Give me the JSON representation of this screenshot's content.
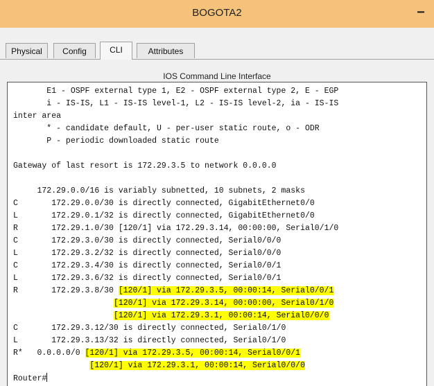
{
  "window": {
    "title": "BOGOTA2",
    "minimize_label": "−"
  },
  "tabs": [
    {
      "label": "Physical",
      "active": false
    },
    {
      "label": "Config",
      "active": false
    },
    {
      "label": "CLI",
      "active": true
    },
    {
      "label": "Attributes",
      "active": false
    }
  ],
  "panel_title": "IOS Command Line Interface",
  "terminal": {
    "lines": [
      "       E1 - OSPF external type 1, E2 - OSPF external type 2, E - EGP",
      "       i - IS-IS, L1 - IS-IS level-1, L2 - IS-IS level-2, ia - IS-IS",
      "inter area",
      "       * - candidate default, U - per-user static route, o - ODR",
      "       P - periodic downloaded static route",
      "",
      "Gateway of last resort is 172.29.3.5 to network 0.0.0.0",
      "",
      "     172.29.0.0/16 is variably subnetted, 10 subnets, 2 masks",
      "C       172.29.0.0/30 is directly connected, GigabitEthernet0/0",
      "L       172.29.0.1/32 is directly connected, GigabitEthernet0/0",
      "R       172.29.1.0/30 [120/1] via 172.29.3.14, 00:00:00, Serial0/1/0",
      "C       172.29.3.0/30 is directly connected, Serial0/0/0",
      "L       172.29.3.2/32 is directly connected, Serial0/0/0",
      "C       172.29.3.4/30 is directly connected, Serial0/0/1",
      "L       172.29.3.6/32 is directly connected, Serial0/0/1",
      "R       172.29.3.8/30 ",
      "                     ",
      "                     ",
      "C       172.29.3.12/30 is directly connected, Serial0/1/0",
      "L       172.29.3.13/32 is directly connected, Serial0/1/0",
      "R*   0.0.0.0/0 ",
      "                ",
      "",
      "Router#"
    ],
    "highlights": [
      "[120/1] via 172.29.3.5, 00:00:14, Serial0/0/1",
      "[120/1] via 172.29.3.14, 00:00:00, Serial0/1/0",
      "[120/1] via 172.29.3.1, 00:00:14, Serial0/0/0",
      "",
      "",
      "[120/1] via 172.29.3.5, 00:00:14, Serial0/0/1",
      "[120/1] via 172.29.3.1, 00:00:14, Serial0/0/0"
    ],
    "highlight_color": "#ffff00"
  }
}
